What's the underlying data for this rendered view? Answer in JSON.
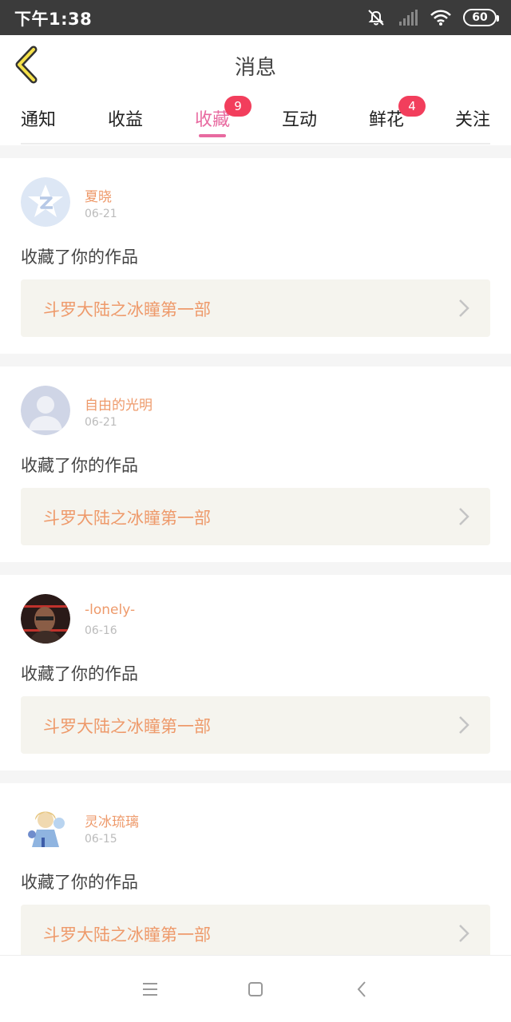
{
  "status": {
    "time": "下午1:38",
    "battery": "60"
  },
  "header": {
    "title": "消息"
  },
  "tabs": [
    {
      "label": "通知",
      "badge": ""
    },
    {
      "label": "收益",
      "badge": ""
    },
    {
      "label": "收藏",
      "badge": "9",
      "active": true
    },
    {
      "label": "互动",
      "badge": ""
    },
    {
      "label": "鲜花",
      "badge": "4"
    },
    {
      "label": "关注",
      "badge": ""
    }
  ],
  "messages": [
    {
      "name": "夏晓",
      "date": "06-21",
      "action": "收藏了你的作品",
      "work": "斗罗大陆之冰瞳第一部",
      "avatar": "qq-default-avatar"
    },
    {
      "name": "自由的光明",
      "date": "06-21",
      "action": "收藏了你的作品",
      "work": "斗罗大陆之冰瞳第一部",
      "avatar": "person-silhouette-avatar"
    },
    {
      "name": "-lonely-",
      "date": "06-16",
      "action": "收藏了你的作品",
      "work": "斗罗大陆之冰瞳第一部",
      "avatar": "photo-avatar"
    },
    {
      "name": "灵冰琉璃",
      "date": "06-15",
      "action": "收藏了你的作品",
      "work": "斗罗大陆之冰瞳第一部",
      "avatar": "anime-avatar"
    }
  ],
  "colors": {
    "accent_pink": "#e86aa0",
    "name_orange": "#ee9a6b",
    "badge_red": "#f23e5c",
    "work_bg": "#f5f4ee"
  }
}
